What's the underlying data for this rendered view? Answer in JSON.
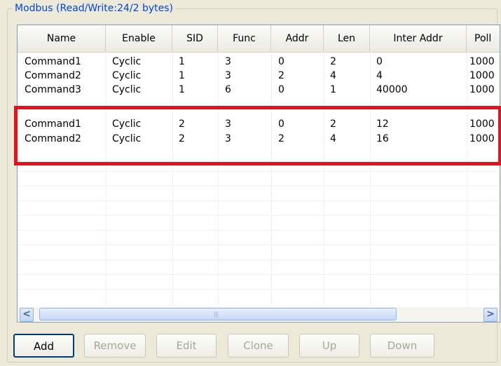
{
  "group": {
    "title": "Modbus (Read/Write:24/2 bytes)"
  },
  "columns": [
    "Name",
    "Enable",
    "SID",
    "Func",
    "Addr",
    "Len",
    "Inter Addr",
    "Poll"
  ],
  "rows": [
    {
      "name": "Command1",
      "enable": "Cyclic",
      "sid": "1",
      "func": "3",
      "addr": "0",
      "len": "2",
      "inter_addr": "0",
      "poll": "1000"
    },
    {
      "name": "Command2",
      "enable": "Cyclic",
      "sid": "1",
      "func": "3",
      "addr": "2",
      "len": "4",
      "inter_addr": "4",
      "poll": "1000"
    },
    {
      "name": "Command3",
      "enable": "Cyclic",
      "sid": "1",
      "func": "6",
      "addr": "0",
      "len": "1",
      "inter_addr": "40000",
      "poll": "1000"
    },
    {
      "name": "Command1",
      "enable": "Cyclic",
      "sid": "2",
      "func": "3",
      "addr": "0",
      "len": "2",
      "inter_addr": "12",
      "poll": "1000"
    },
    {
      "name": "Command2",
      "enable": "Cyclic",
      "sid": "2",
      "func": "3",
      "addr": "2",
      "len": "4",
      "inter_addr": "16",
      "poll": "1000"
    }
  ],
  "scrollbar": {
    "left_arrow": "<",
    "right_arrow": ">",
    "grip": "|||"
  },
  "buttons": {
    "add": "Add",
    "remove": "Remove",
    "edit": "Edit",
    "clone": "Clone",
    "up": "Up",
    "down": "Down"
  },
  "colors": {
    "highlight": "#e1141e",
    "title": "#0046d5"
  }
}
